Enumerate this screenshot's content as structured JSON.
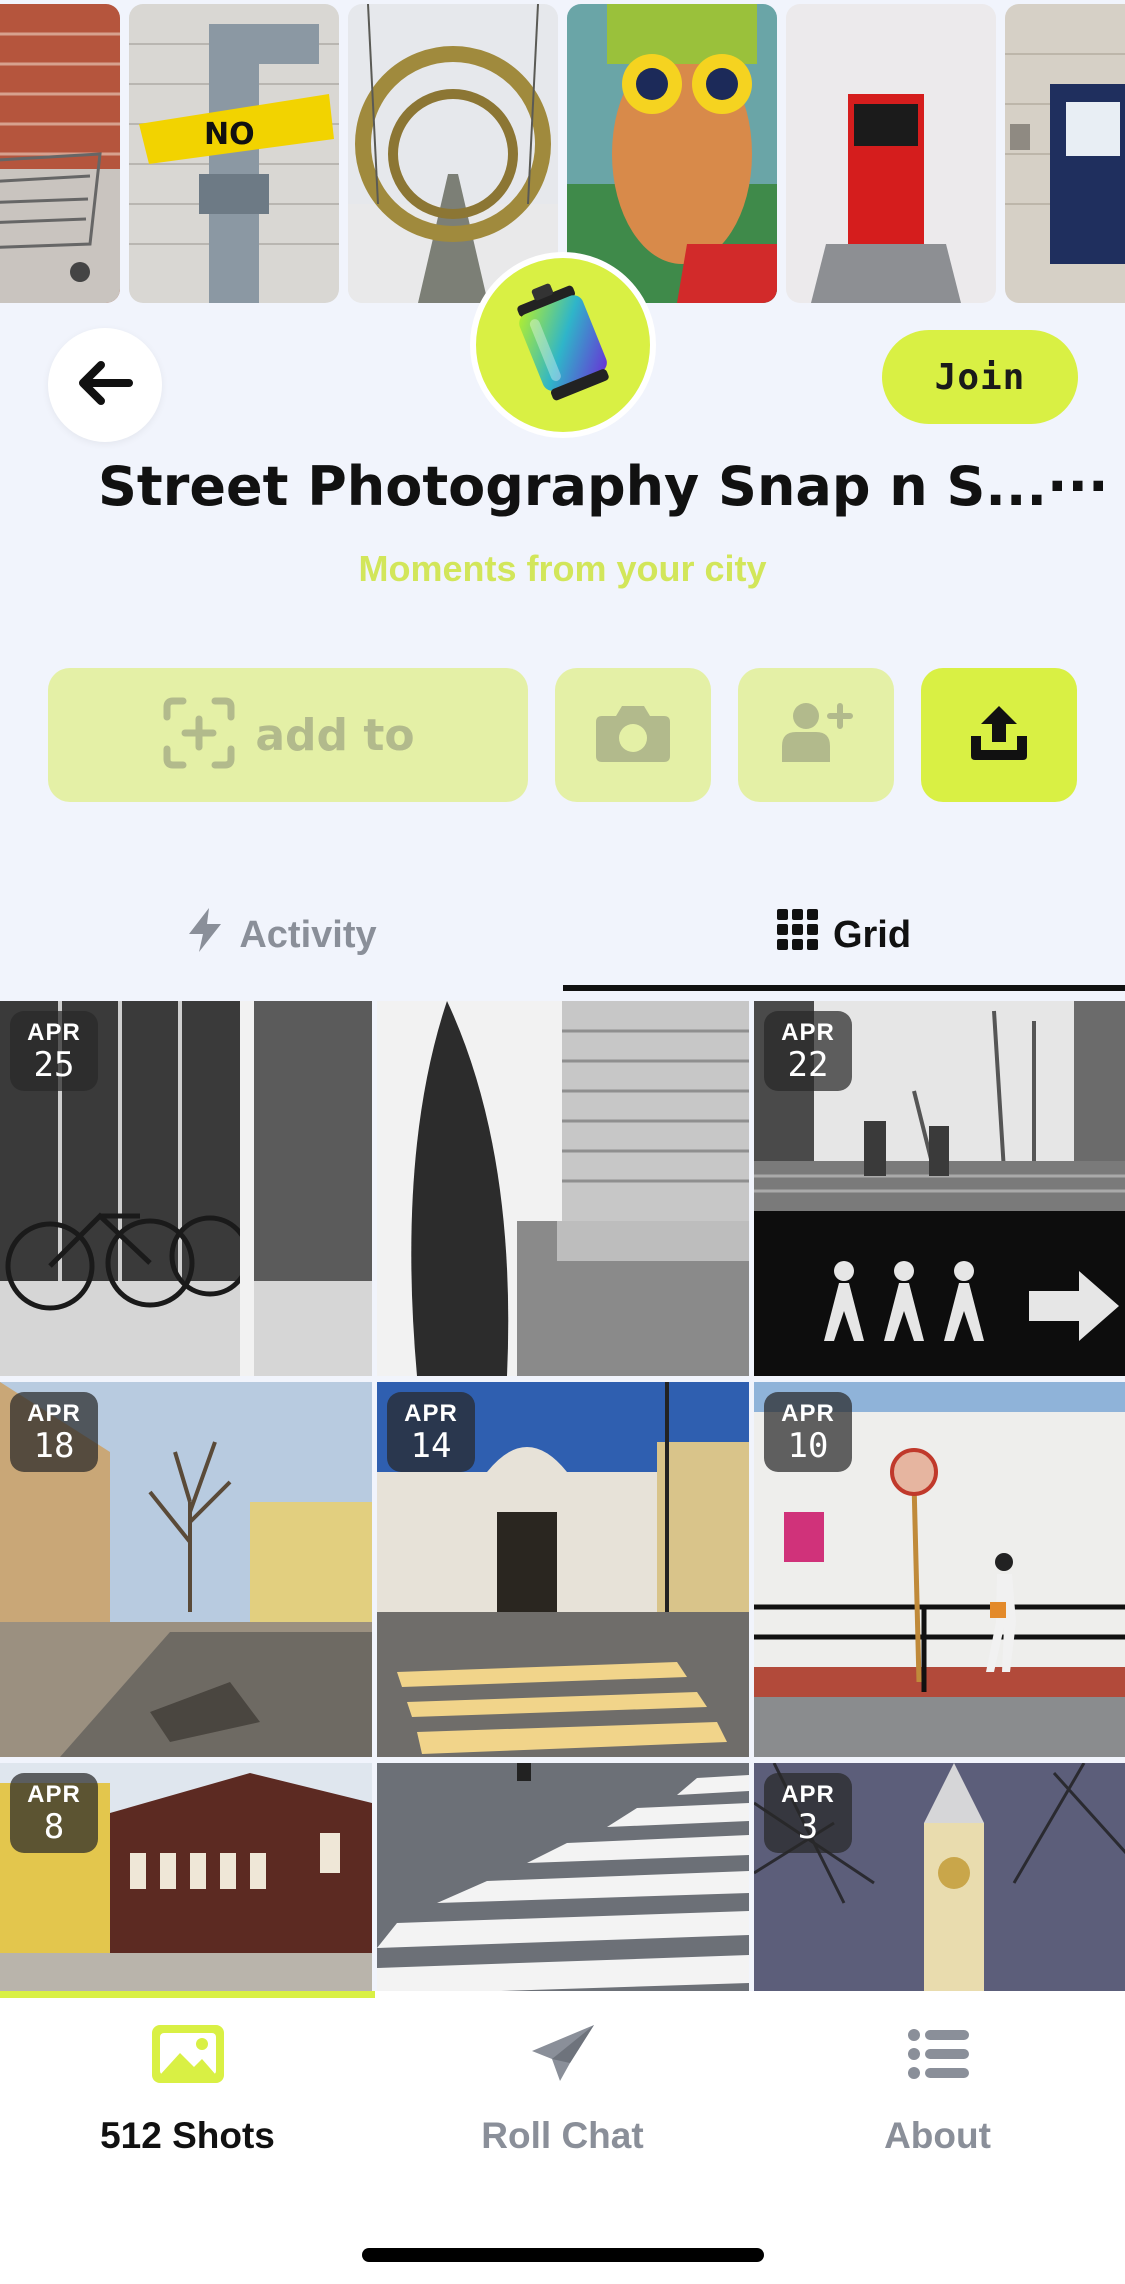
{
  "header": {
    "join_label": "Join",
    "title": "Street Photography Snap n S...···",
    "subtitle": "Moments from your city"
  },
  "actions": {
    "add_to_label": "add to"
  },
  "tabs": [
    {
      "label": "Activity",
      "active": false
    },
    {
      "label": "Grid",
      "active": true
    }
  ],
  "grid": {
    "tiles": [
      {
        "month": "APR",
        "day": "25"
      },
      {
        "month": "",
        "day": ""
      },
      {
        "month": "APR",
        "day": "22"
      },
      {
        "month": "APR",
        "day": "18"
      },
      {
        "month": "APR",
        "day": "14"
      },
      {
        "month": "APR",
        "day": "10"
      },
      {
        "month": "APR",
        "day": "8"
      },
      {
        "month": "",
        "day": ""
      },
      {
        "month": "APR",
        "day": "3"
      }
    ]
  },
  "bottom_nav": [
    {
      "label": "512 Shots",
      "icon": "photo-icon",
      "active": true
    },
    {
      "label": "Roll Chat",
      "icon": "paper-plane-icon",
      "active": false
    },
    {
      "label": "About",
      "icon": "list-icon",
      "active": false
    }
  ],
  "colors": {
    "accent": "#d9f044",
    "background": "#f1f4fc",
    "muted": "#8a8f99"
  }
}
